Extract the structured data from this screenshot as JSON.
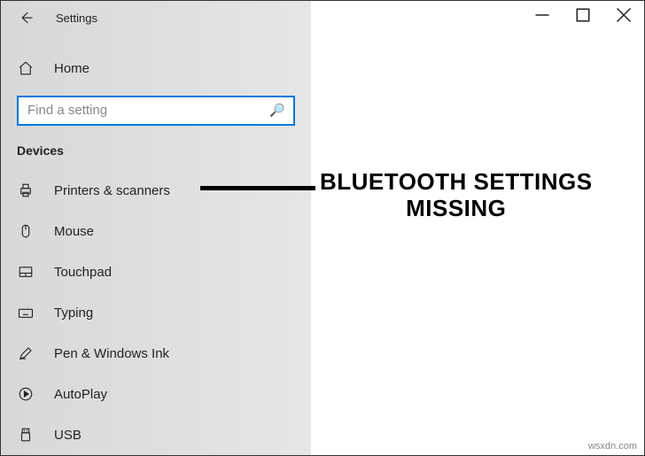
{
  "window": {
    "title": "Settings"
  },
  "sidebar": {
    "home_label": "Home",
    "search_placeholder": "Find a setting",
    "section_header": "Devices",
    "items": [
      {
        "label": "Printers & scanners"
      },
      {
        "label": "Mouse"
      },
      {
        "label": "Touchpad"
      },
      {
        "label": "Typing"
      },
      {
        "label": "Pen & Windows Ink"
      },
      {
        "label": "AutoPlay"
      },
      {
        "label": "USB"
      }
    ]
  },
  "annotation": {
    "line1": "BLUETOOTH SETTINGS",
    "line2": "MISSING"
  },
  "watermark": "wsxdn.com"
}
